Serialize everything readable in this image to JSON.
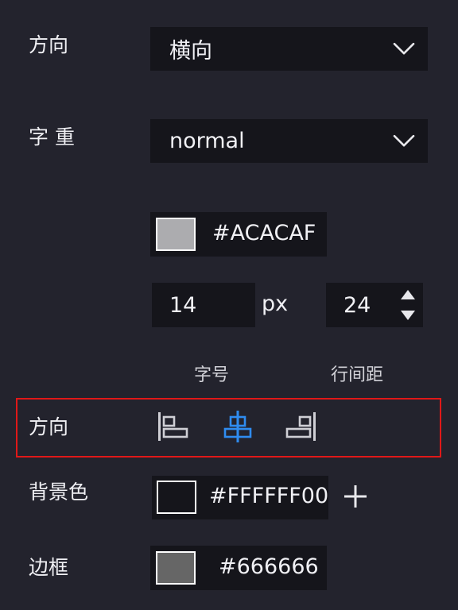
{
  "direction_row": {
    "label": "方向",
    "select_value": "横向"
  },
  "weight_row": {
    "label": "字 重",
    "select_value": "normal"
  },
  "font_color": {
    "hex": "#ACACAF",
    "swatch_color": "#ACACAF"
  },
  "font_size": {
    "value": "14",
    "unit": "px",
    "caption": "字号"
  },
  "line_height": {
    "value": "24",
    "caption": "行间距"
  },
  "align_row": {
    "label": "方向",
    "options": [
      {
        "icon": "align-left-icon",
        "active": false
      },
      {
        "icon": "align-center-icon",
        "active": true
      },
      {
        "icon": "align-right-icon",
        "active": false
      }
    ],
    "active_color": "#2f8cf0",
    "inactive_color": "#cfcfd5",
    "highlight_color": "#e01818"
  },
  "background_color": {
    "label": "背景色",
    "hex": "#FFFFFF00",
    "swatch_color": "#15151b"
  },
  "border_color": {
    "label": "边框",
    "hex": "#666666",
    "swatch_color": "#666666"
  }
}
